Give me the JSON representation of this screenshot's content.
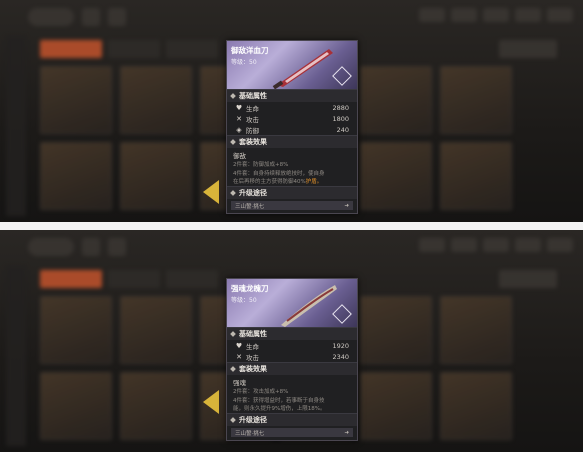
{
  "panels": [
    {
      "item_name": "御敌洋血刀",
      "level_text": "等级：50",
      "accent": "#8a7ab0",
      "base_section": "基础属性",
      "stats": [
        {
          "icon": "heart-icon",
          "glyph": "♥",
          "label": "生命",
          "value": "2880"
        },
        {
          "icon": "swords-icon",
          "glyph": "✕",
          "label": "攻击",
          "value": "1800"
        },
        {
          "icon": "shield-icon",
          "glyph": "◈",
          "label": "防御",
          "value": "240"
        }
      ],
      "set_section": "套装效果",
      "set_name": "御敌",
      "set_desc_1": "2件套：防御加成+8%",
      "set_desc_2a": "4件套：自身持续释放绝技时，使自身",
      "set_desc_2b": "在后再移的主方获得防御40%",
      "set_desc_2c": "护盾。",
      "upgrade_section": "升级途径",
      "path_label": "三山誓·挑七",
      "path_arrow": "➜"
    },
    {
      "item_name": "强魂龙魄刀",
      "level_text": "等级：50",
      "accent": "#8a7ab0",
      "base_section": "基础属性",
      "stats": [
        {
          "icon": "heart-icon",
          "glyph": "♥",
          "label": "生命",
          "value": "1920"
        },
        {
          "icon": "swords-icon",
          "glyph": "✕",
          "label": "攻击",
          "value": "2340"
        }
      ],
      "set_section": "套装效果",
      "set_name": "强魂",
      "set_desc_1": "2件套：攻击加成+8%",
      "set_desc_2a": "4件套：获得增益时，若事断于自身技",
      "set_desc_2b": "能，则永久提升9%增伤，上限18%。",
      "set_desc_2c": "",
      "upgrade_section": "升级途径",
      "path_label": "三山誓·挑七",
      "path_arrow": "➜"
    }
  ]
}
